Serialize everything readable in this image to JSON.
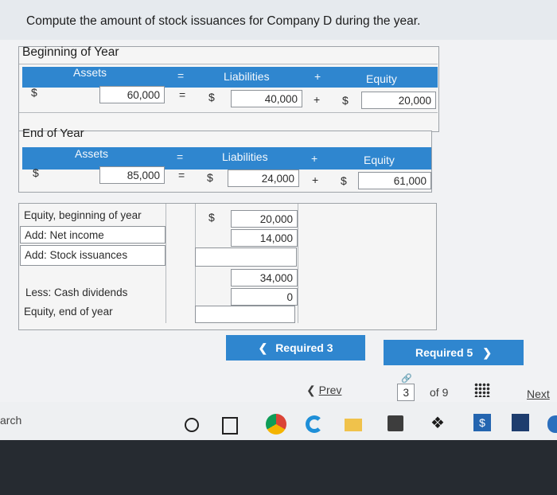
{
  "question": "Compute the amount of stock issuances for Company D during the year.",
  "beginning": {
    "title": "Beginning of Year",
    "assets_label": "Assets",
    "liabilities_label": "Liabilities",
    "equity_label": "Equity",
    "eq_sign": "=",
    "plus_sign": "+",
    "dollar": "$",
    "assets": "60,000",
    "liabilities": "40,000",
    "equity": "20,000"
  },
  "end": {
    "title": "End of Year",
    "assets_label": "Assets",
    "liabilities_label": "Liabilities",
    "equity_label": "Equity",
    "eq_sign": "=",
    "plus_sign": "+",
    "dollar": "$",
    "assets": "85,000",
    "liabilities": "24,000",
    "equity": "61,000"
  },
  "analysis": {
    "rows": [
      {
        "label": "Equity, beginning of year",
        "value": "20,000",
        "dollar": "$"
      },
      {
        "label": "Add: Net income",
        "value": "14,000"
      },
      {
        "label": "Add: Stock issuances",
        "value": ""
      },
      {
        "label": "",
        "value": "34,000"
      },
      {
        "label": "Less: Cash dividends",
        "value": "0"
      },
      {
        "label": "Equity, end of year",
        "value": ""
      }
    ]
  },
  "nav": {
    "required3": "Required 3",
    "required5": "Required 5",
    "prev": "Prev",
    "page_current": "3",
    "page_of": "of 9",
    "next": "Next"
  },
  "taskbar": {
    "search_fragment": "arch"
  },
  "colors": {
    "accent": "#2f86cf",
    "background": "#f1f2f4"
  }
}
